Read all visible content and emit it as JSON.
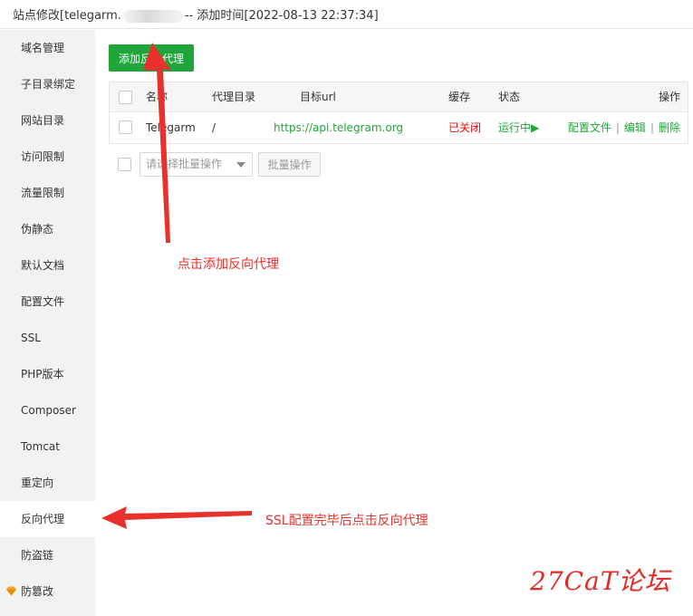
{
  "window": {
    "title_prefix": "站点修改[telegarm.",
    "title_suffix": "-- 添加时间[2022-08-13 22:37:34]"
  },
  "sidebar": {
    "items": [
      {
        "label": "域名管理"
      },
      {
        "label": "子目录绑定"
      },
      {
        "label": "网站目录"
      },
      {
        "label": "访问限制"
      },
      {
        "label": "流量限制"
      },
      {
        "label": "伪静态"
      },
      {
        "label": "默认文档"
      },
      {
        "label": "配置文件"
      },
      {
        "label": "SSL"
      },
      {
        "label": "PHP版本"
      },
      {
        "label": "Composer"
      },
      {
        "label": "Tomcat"
      },
      {
        "label": "重定向"
      },
      {
        "label": "反向代理",
        "active": true
      },
      {
        "label": "防盗链"
      },
      {
        "label": "防篡改",
        "icon": "diamond-icon"
      }
    ]
  },
  "toolbar": {
    "add_label": "添加反向代理"
  },
  "table": {
    "headers": {
      "name": "名称",
      "dir": "代理目录",
      "target": "目标url",
      "cache": "缓存",
      "status": "状态",
      "actions": "操作"
    },
    "rows": [
      {
        "name": "Telegarm",
        "dir": "/",
        "target": "https://api.telegram.org",
        "cache": "已关闭",
        "status": "运行中▶",
        "config": "配置文件",
        "edit": "编辑",
        "delete": "删除",
        "separator": "|"
      }
    ]
  },
  "batch": {
    "placeholder": "请选择批量操作",
    "button": "批量操作"
  },
  "annotations": {
    "add_hint": "点击添加反向代理",
    "proxy_hint": "SSL配置完毕后点击反向代理"
  },
  "watermark": "27CaT论坛",
  "colors": {
    "accent_green": "#20a53a",
    "status_red": "#ef0808",
    "annotation_red": "#e8302c",
    "sidebar_bg": "#f2f2f2"
  }
}
